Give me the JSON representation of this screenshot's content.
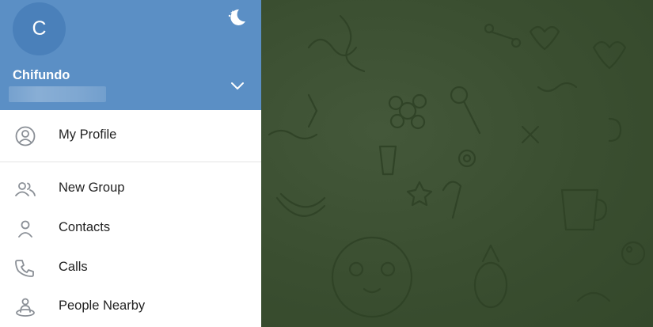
{
  "drawer": {
    "avatar_initial": "C",
    "user_name": "Chifundo",
    "phone_masked": "",
    "night_mode_icon": "moon-icon",
    "account_toggle_icon": "chevron-down-icon",
    "menu": [
      {
        "label": "My Profile",
        "icon": "profile-icon"
      },
      {
        "label": "New Group",
        "icon": "group-icon"
      },
      {
        "label": "Contacts",
        "icon": "contact-icon"
      },
      {
        "label": "Calls",
        "icon": "phone-icon"
      },
      {
        "label": "People Nearby",
        "icon": "people-nearby-icon"
      }
    ]
  },
  "colors": {
    "header": "#5b8fc5",
    "avatar": "#4a80ba",
    "wallpaper": "#3b4f31",
    "text": "#222222",
    "icon": "#8a8f96"
  }
}
